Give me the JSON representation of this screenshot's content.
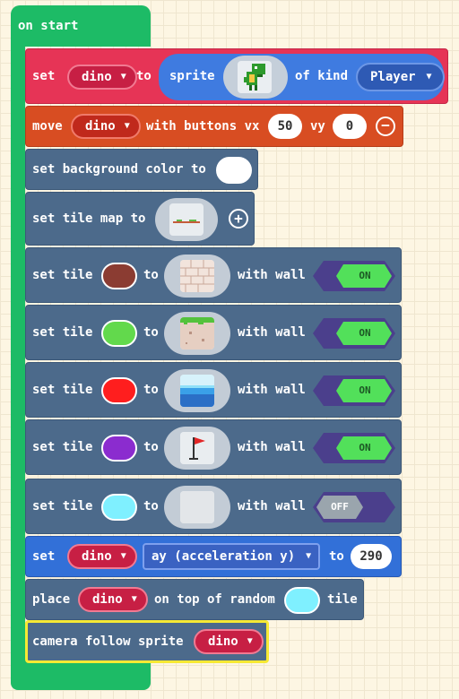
{
  "hat": {
    "label": "on start"
  },
  "set_sprite": {
    "set": "set",
    "var": "dino",
    "to": "to",
    "sprite": "sprite",
    "of_kind": "of kind",
    "kind": "Player"
  },
  "move": {
    "move": "move",
    "var": "dino",
    "with_buttons": "with buttons vx",
    "vx": "50",
    "vy_label": "vy",
    "vy": "0"
  },
  "bg": {
    "label": "set background color to",
    "color": "#ffffff"
  },
  "tilemap": {
    "label": "set tile map to"
  },
  "tiles": [
    {
      "set": "set tile",
      "to": "to",
      "with_wall": "with wall",
      "color": "#8b3c32",
      "wall": "ON",
      "image": "brick"
    },
    {
      "set": "set tile",
      "to": "to",
      "with_wall": "with wall",
      "color": "#62d94c",
      "wall": "ON",
      "image": "grass"
    },
    {
      "set": "set tile",
      "to": "to",
      "with_wall": "with wall",
      "color": "#ff1e1e",
      "wall": "ON",
      "image": "water"
    },
    {
      "set": "set tile",
      "to": "to",
      "with_wall": "with wall",
      "color": "#8b2ccf",
      "wall": "ON",
      "image": "flag"
    },
    {
      "set": "set tile",
      "to": "to",
      "with_wall": "with wall",
      "color": "#7ff0ff",
      "wall": "OFF",
      "image": "empty"
    }
  ],
  "accel": {
    "set": "set",
    "var": "dino",
    "prop": "ay (acceleration y)",
    "to": "to",
    "value": "290"
  },
  "place": {
    "place": "place",
    "var": "dino",
    "on_top": "on top of random",
    "tile": "tile",
    "color": "#7ff0ff"
  },
  "camera": {
    "label": "camera follow sprite",
    "var": "dino"
  },
  "colors": {
    "on_green": "#52e05a",
    "off_gray": "#9aa5ad",
    "toggle_bg": "#4b3f8c"
  }
}
